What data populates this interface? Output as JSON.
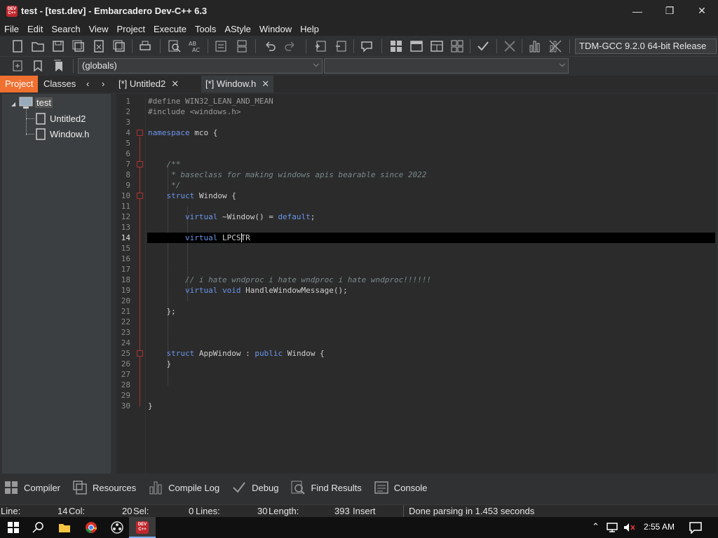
{
  "window": {
    "title": "test - [test.dev] - Embarcadero Dev-C++ 6.3",
    "app_icon_text": "DEV C++",
    "controls": {
      "minimize": "—",
      "maximize": "❐",
      "close": "✕"
    }
  },
  "menu": [
    "File",
    "Edit",
    "Search",
    "View",
    "Project",
    "Execute",
    "Tools",
    "AStyle",
    "Window",
    "Help"
  ],
  "toolbar": {
    "compiler": "TDM-GCC 9.2.0 64-bit Release",
    "scope_combo": "(globals)",
    "function_combo": ""
  },
  "left_panel": {
    "tabs": [
      "Project",
      "Classes"
    ],
    "nav_prev": "‹",
    "nav_next": "›",
    "tree": {
      "root": "test",
      "children": [
        "Untitled2",
        "Window.h"
      ]
    }
  },
  "editor_tabs": [
    {
      "label": "[*] Untitled2",
      "close": "✕"
    },
    {
      "label": "[*] Window.h",
      "close": "✕"
    }
  ],
  "code": {
    "line_numbers": [
      "1",
      "2",
      "3",
      "4",
      "5",
      "6",
      "7",
      "8",
      "9",
      "10",
      "11",
      "12",
      "13",
      "14",
      "15",
      "16",
      "17",
      "18",
      "19",
      "20",
      "21",
      "22",
      "23",
      "24",
      "25",
      "26",
      "27",
      "28",
      "29",
      "30"
    ],
    "current_line": 14,
    "lines": {
      "l1": "#define WIN32_LEAN_AND_MEAN",
      "l2": "#include <windows.h>",
      "l4a": "namespace",
      "l4b": " mco {",
      "l7": "    /**",
      "l8": "     * baseclass for making windows apis bearable since 2022",
      "l9": "     */",
      "l10a": "    struct",
      "l10b": " Window {",
      "l12a": "        virtual",
      "l12b": " ~Window() = ",
      "l12c": "default",
      "l12d": ";",
      "l14a": "        virtual",
      "l14b": " LPCSTR",
      "l18": "        // i hate wndproc i hate wndproc i hate wndproc!!!!!!",
      "l19a": "        virtual void",
      "l19b": " HandleWindowMessage();",
      "l21": "    };",
      "l25a": "    struct",
      "l25b": " AppWindow : ",
      "l25c": "public",
      "l25d": " Window {",
      "l26": "    }",
      "l30": "}"
    }
  },
  "bottom_tabs": [
    "Compiler",
    "Resources",
    "Compile Log",
    "Debug",
    "Find Results",
    "Console"
  ],
  "status": {
    "line_label": "Line:",
    "line_value": "14",
    "col_label": "Col:",
    "col_value": "20",
    "sel_label": "Sel:",
    "sel_value": "0",
    "lines_label": "Lines:",
    "lines_value": "30",
    "length_label": "Length:",
    "length_value": "393",
    "mode": "Insert",
    "message": "Done parsing in 1.453 seconds"
  },
  "taskbar": {
    "time": "2:55 AM"
  }
}
